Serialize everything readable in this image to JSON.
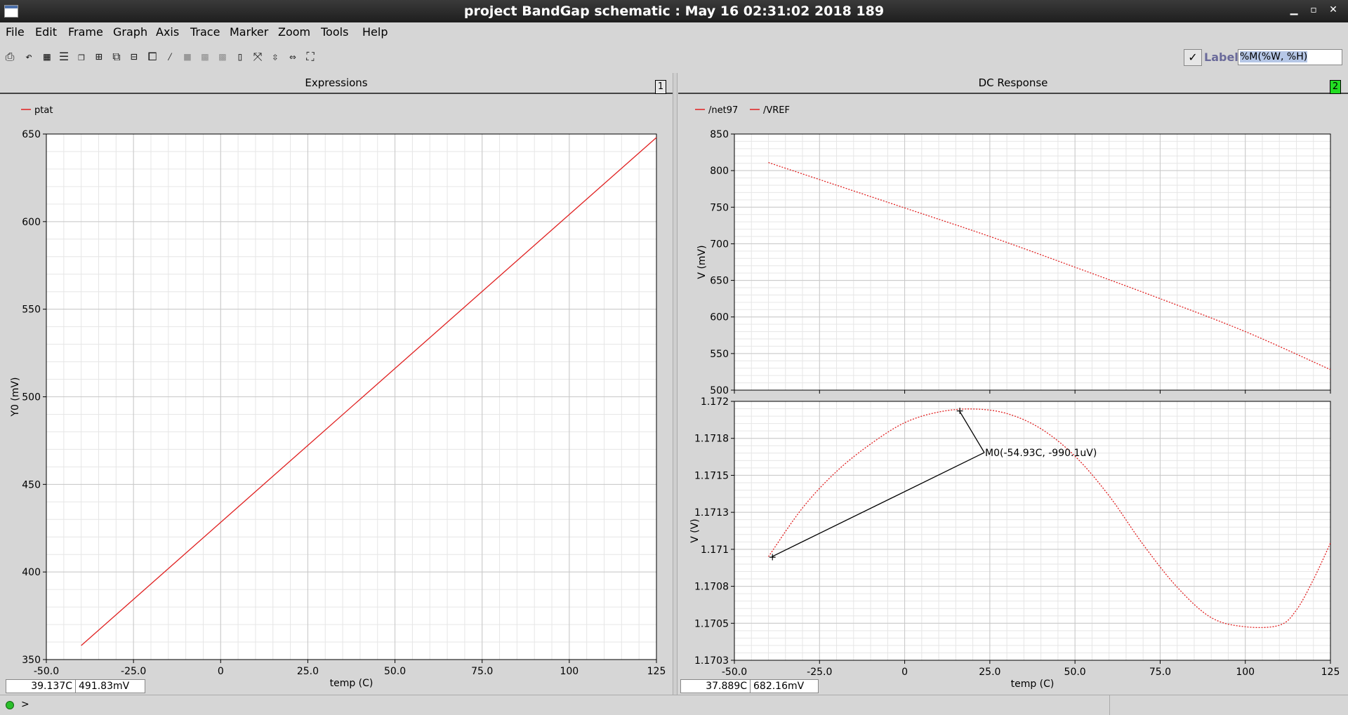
{
  "window": {
    "title": "project BandGap schematic : May 16 02:31:02 2018 189",
    "min": "▁",
    "max": "▫",
    "close": "✕"
  },
  "menu": [
    "File",
    "Edit",
    "Frame",
    "Graph",
    "Axis",
    "Trace",
    "Marker",
    "Zoom",
    "Tools",
    "Help"
  ],
  "toolbar": {
    "icons": [
      "print-icon",
      "undo-icon",
      "grid-icon",
      "strip-icon",
      "stack-icon",
      "frame-icon",
      "frame2-icon",
      "frame3-icon",
      "new-window-icon",
      "subwindow-icon",
      "disabled-icon",
      "disabled2-icon",
      "disabled3-icon",
      "calc-icon",
      "fit-icon",
      "fit-y-icon",
      "fit-x-icon",
      "zoom-fit-icon"
    ],
    "label_check": "✓",
    "label_text": "Label",
    "label_value": "%M(%W, %H)"
  },
  "colors": {
    "trace": "#e02020",
    "grid_major": "#c8c8c8",
    "grid_minor": "#e6e6e6",
    "plot_bg": "#ffffff",
    "active_frame": "#22dd22"
  },
  "left_panel": {
    "title": "Expressions",
    "number": "1",
    "status_x": "39.137C",
    "status_y": "491.83mV"
  },
  "right_panel": {
    "title": "DC Response",
    "number": "2",
    "status_x": "37.889C",
    "status_y": "682.16mV"
  },
  "chart_data": [
    {
      "type": "line",
      "title": "Expressions",
      "xlabel": "temp (C)",
      "ylabel": "Y0 (mV)",
      "xlim": [
        -50,
        125
      ],
      "ylim": [
        350,
        650
      ],
      "xticks": [
        "-50.0",
        "-25.0",
        "0",
        "25.0",
        "50.0",
        "75.0",
        "100",
        "125"
      ],
      "yticks": [
        "350",
        "400",
        "450",
        "500",
        "550",
        "600",
        "650"
      ],
      "legend": "top-left",
      "grid": true,
      "series": [
        {
          "name": "ptat",
          "x": [
            -40,
            125
          ],
          "y": [
            358,
            648
          ]
        }
      ]
    },
    {
      "type": "line",
      "title": "DC Response",
      "xlabel": "",
      "ylabel": "V (mV)",
      "xlim": [
        -50,
        125
      ],
      "ylim": [
        500,
        850
      ],
      "xticks": [],
      "yticks": [
        "500",
        "550",
        "600",
        "650",
        "700",
        "750",
        "800",
        "850"
      ],
      "legend": "top-left",
      "grid": true,
      "series": [
        {
          "name": "/net97",
          "x": [
            -40,
            0,
            25,
            50,
            75,
            100,
            125
          ],
          "y": [
            811,
            749,
            710,
            668,
            625,
            580,
            528
          ]
        }
      ]
    },
    {
      "type": "line",
      "xlabel": "temp (C)",
      "ylabel": "V (V)",
      "xlim": [
        -50,
        125
      ],
      "ylim": [
        1.1703,
        1.172
      ],
      "xticks": [
        "-50.0",
        "-25.0",
        "0",
        "25.0",
        "50.0",
        "75.0",
        "100",
        "125"
      ],
      "yticks": [
        "1.1703",
        "1.1705",
        "1.1708",
        "1.171",
        "1.1713",
        "1.1715",
        "1.1718",
        "1.172"
      ],
      "grid": true,
      "series": [
        {
          "name": "/VREF",
          "x": [
            -40,
            -30,
            -20,
            -10,
            0,
            10,
            20,
            30,
            40,
            50,
            60,
            70,
            80,
            90,
            100,
            110,
            115,
            120,
            125
          ],
          "y": [
            1.17098,
            1.1713,
            1.17154,
            1.17172,
            1.17186,
            1.17193,
            1.17195,
            1.17192,
            1.17182,
            1.17164,
            1.17138,
            1.17106,
            1.17078,
            1.17058,
            1.17052,
            1.17053,
            1.17063,
            1.17083,
            1.17107
          ]
        }
      ],
      "annotation": {
        "text": "M0(-54.93C, -990.1uV)",
        "point_a": [
          16,
          1.17194
        ],
        "point_b": [
          -39,
          1.17098
        ]
      }
    }
  ]
}
